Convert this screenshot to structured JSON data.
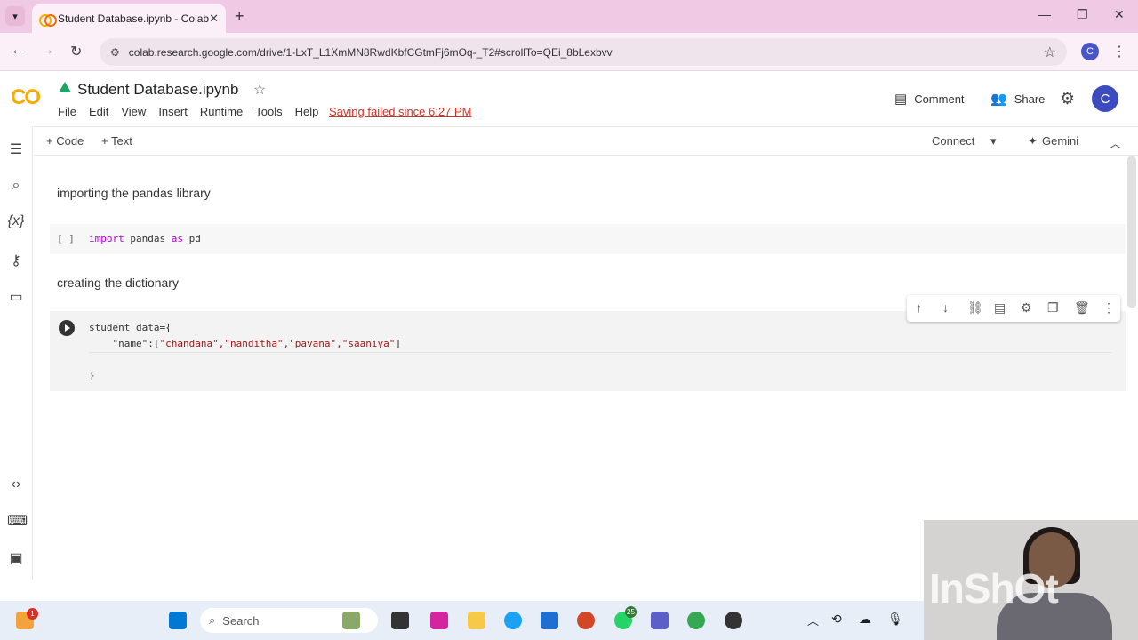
{
  "browser": {
    "tab_title": "Student Database.ipynb - Colab",
    "url": "colab.research.google.com/drive/1-LxT_L1XmMN8RwdKbfCGtmFj6mOq-_T2#scrollTo=QEi_8bLexbvv",
    "profile_initial": "C"
  },
  "colab": {
    "logo": "CO",
    "notebook_title": "Student Database.ipynb",
    "menu": [
      "File",
      "Edit",
      "View",
      "Insert",
      "Runtime",
      "Tools",
      "Help"
    ],
    "save_status": "Saving failed since 6:27 PM",
    "comment_label": "Comment",
    "share_label": "Share",
    "avatar_initial": "C",
    "add_code": "+ Code",
    "add_text": "+ Text",
    "connect_label": "Connect",
    "gemini_label": "Gemini"
  },
  "cells": {
    "md1": "importing the pandas library",
    "code1_bracket": "[ ]",
    "code1_kw1": "import",
    "code1_mid": " pandas ",
    "code1_kw2": "as",
    "code1_end": " pd",
    "md2": "creating the dictionary",
    "code2_line1": "student data={",
    "code2_key": "    \"name\":[",
    "code2_values": "\"chandana\",\"nanditha\",\"pavana\",\"saaniya\"",
    "code2_close": "]",
    "code2_line3": "}"
  },
  "taskbar": {
    "search_placeholder": "Search",
    "whatsapp_badge": "25",
    "notif_badge": "1"
  },
  "overlay": {
    "watermark": "InShOt"
  },
  "colors": {
    "tab_strip": "#f0c9e4",
    "colab_orange": "#f9ab00",
    "error_red": "#d93025"
  }
}
